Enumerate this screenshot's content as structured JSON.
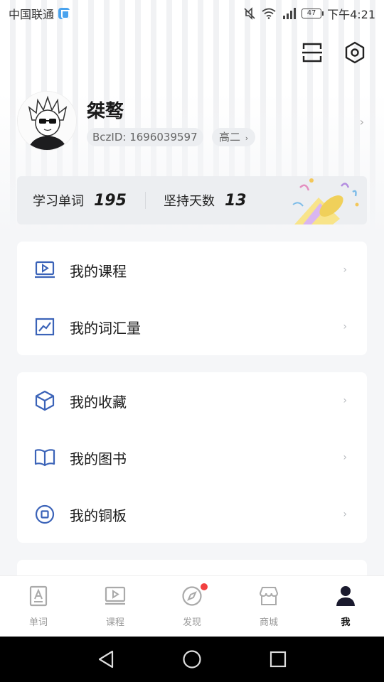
{
  "status_bar": {
    "carrier": "中国联通",
    "battery": "47",
    "time": "下午4:21"
  },
  "profile": {
    "name": "桀骜",
    "bcz_id": "BczID: 1696039597",
    "grade": "高二"
  },
  "stats": {
    "words_label": "学习单词",
    "words_value": "195",
    "days_label": "坚持天数",
    "days_value": "13"
  },
  "menu_group_1": [
    {
      "label": "我的课程",
      "icon": "course-screen-icon"
    },
    {
      "label": "我的词汇量",
      "icon": "chart-icon"
    }
  ],
  "menu_group_2": [
    {
      "label": "我的收藏",
      "icon": "cube-icon"
    },
    {
      "label": "我的图书",
      "icon": "book-icon"
    },
    {
      "label": "我的铜板",
      "icon": "coin-icon"
    }
  ],
  "tabbar": [
    {
      "label": "单词",
      "icon": "word-card-icon",
      "active": false
    },
    {
      "label": "课程",
      "icon": "course-play-icon",
      "active": false
    },
    {
      "label": "发现",
      "icon": "compass-icon",
      "active": false,
      "badge": true
    },
    {
      "label": "商城",
      "icon": "shop-icon",
      "active": false
    },
    {
      "label": "我",
      "icon": "person-icon",
      "active": true
    }
  ],
  "colors": {
    "accent_icon": "#3b63b8",
    "badge": "#f24040",
    "background": "#f5f6f8"
  }
}
